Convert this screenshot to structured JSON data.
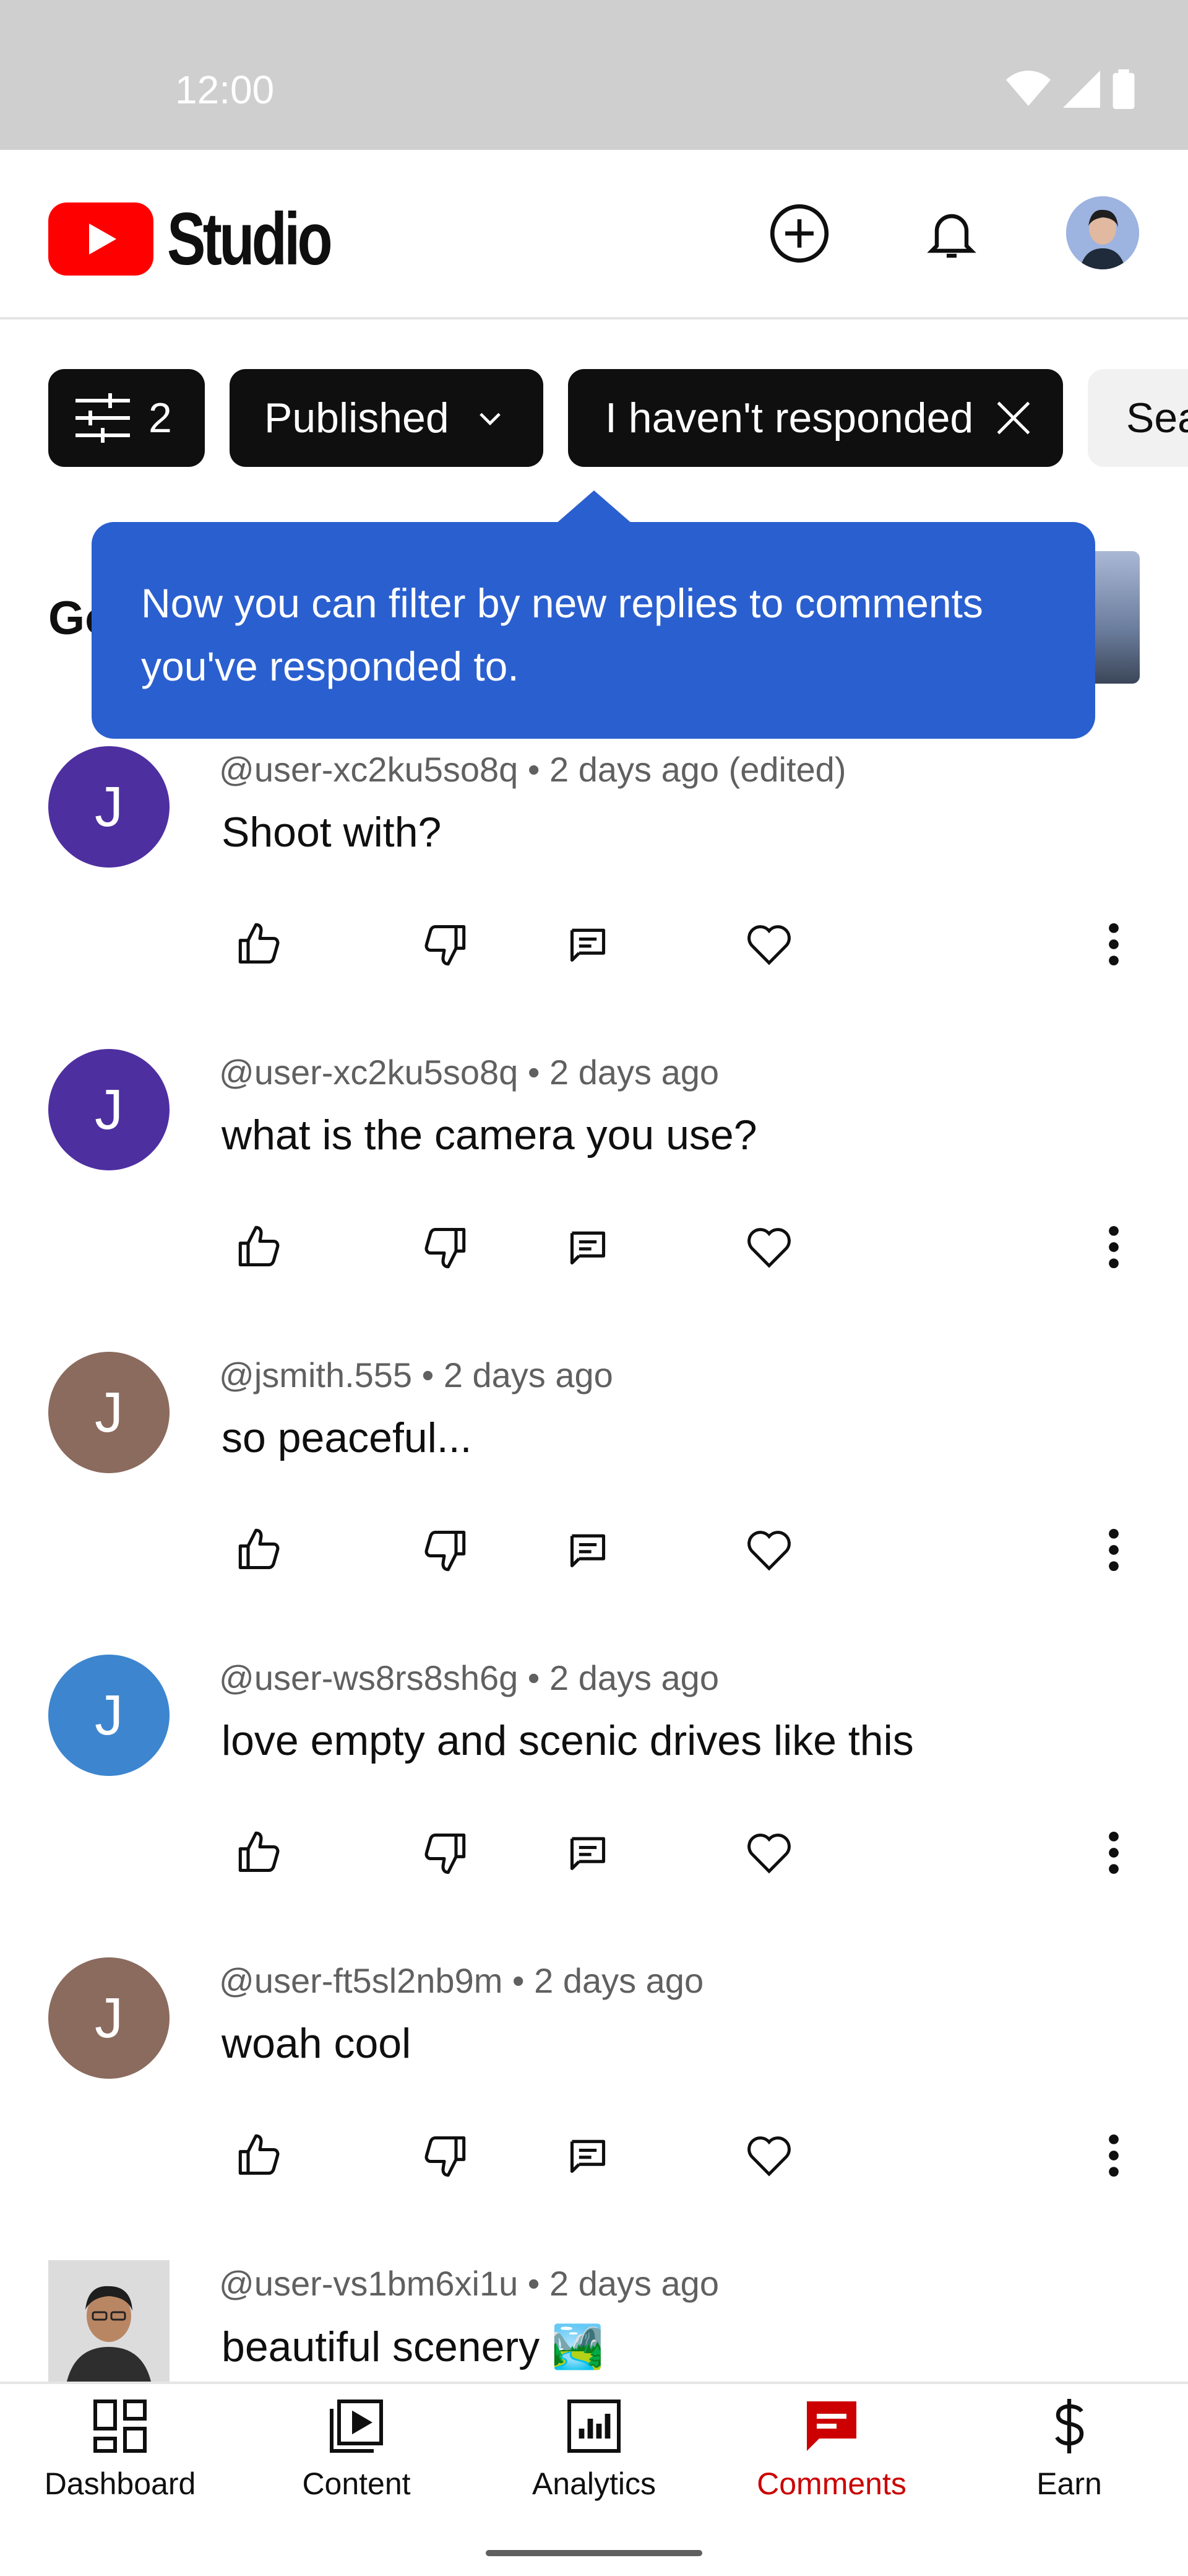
{
  "status_bar": {
    "time": "12:00"
  },
  "header": {
    "app_name": "Studio"
  },
  "filters": {
    "count": "2",
    "published_label": "Published",
    "responded_label": "I haven't responded",
    "search_label": "Sea"
  },
  "tooltip": {
    "text": "Now you can filter by new replies to comments you've responded to."
  },
  "video_title_peek": "Go",
  "comments": [
    {
      "initial": "J",
      "author": "@user-xc2ku5so8q",
      "time": "2 days ago (edited)",
      "text": "Shoot with?",
      "avatar_color": "#4e2fa0"
    },
    {
      "initial": "J",
      "author": "@user-xc2ku5so8q",
      "time": "2 days ago",
      "text": "what is the camera you use?",
      "avatar_color": "#4e2fa0"
    },
    {
      "initial": "J",
      "author": "@jsmith.555",
      "time": "2 days ago",
      "text": "so peaceful...",
      "avatar_color": "#8b6b5e"
    },
    {
      "initial": "J",
      "author": "@user-ws8rs8sh6g",
      "time": "2 days ago",
      "text": "love empty and scenic drives like this",
      "avatar_color": "#3d86cf"
    },
    {
      "initial": "J",
      "author": "@user-ft5sl2nb9m",
      "time": "2 days ago",
      "text": "woah cool",
      "avatar_color": "#8b6b5e"
    },
    {
      "initial": "",
      "author": "@user-vs1bm6xi1u",
      "time": "2 days ago",
      "text": "beautiful scenery 🏞️",
      "avatar_color": "#d9d9d9"
    }
  ],
  "bottom_nav": {
    "items": [
      {
        "label": "Dashboard",
        "icon": "dashboard-icon"
      },
      {
        "label": "Content",
        "icon": "content-icon"
      },
      {
        "label": "Analytics",
        "icon": "analytics-icon"
      },
      {
        "label": "Comments",
        "icon": "comments-icon",
        "active": true
      },
      {
        "label": "Earn",
        "icon": "earn-icon"
      }
    ]
  },
  "colors": {
    "brand_red": "#ff0000",
    "active_red": "#cc0000",
    "tooltip_blue": "#2a5fcf",
    "chip_dark": "#0f0f0f"
  }
}
